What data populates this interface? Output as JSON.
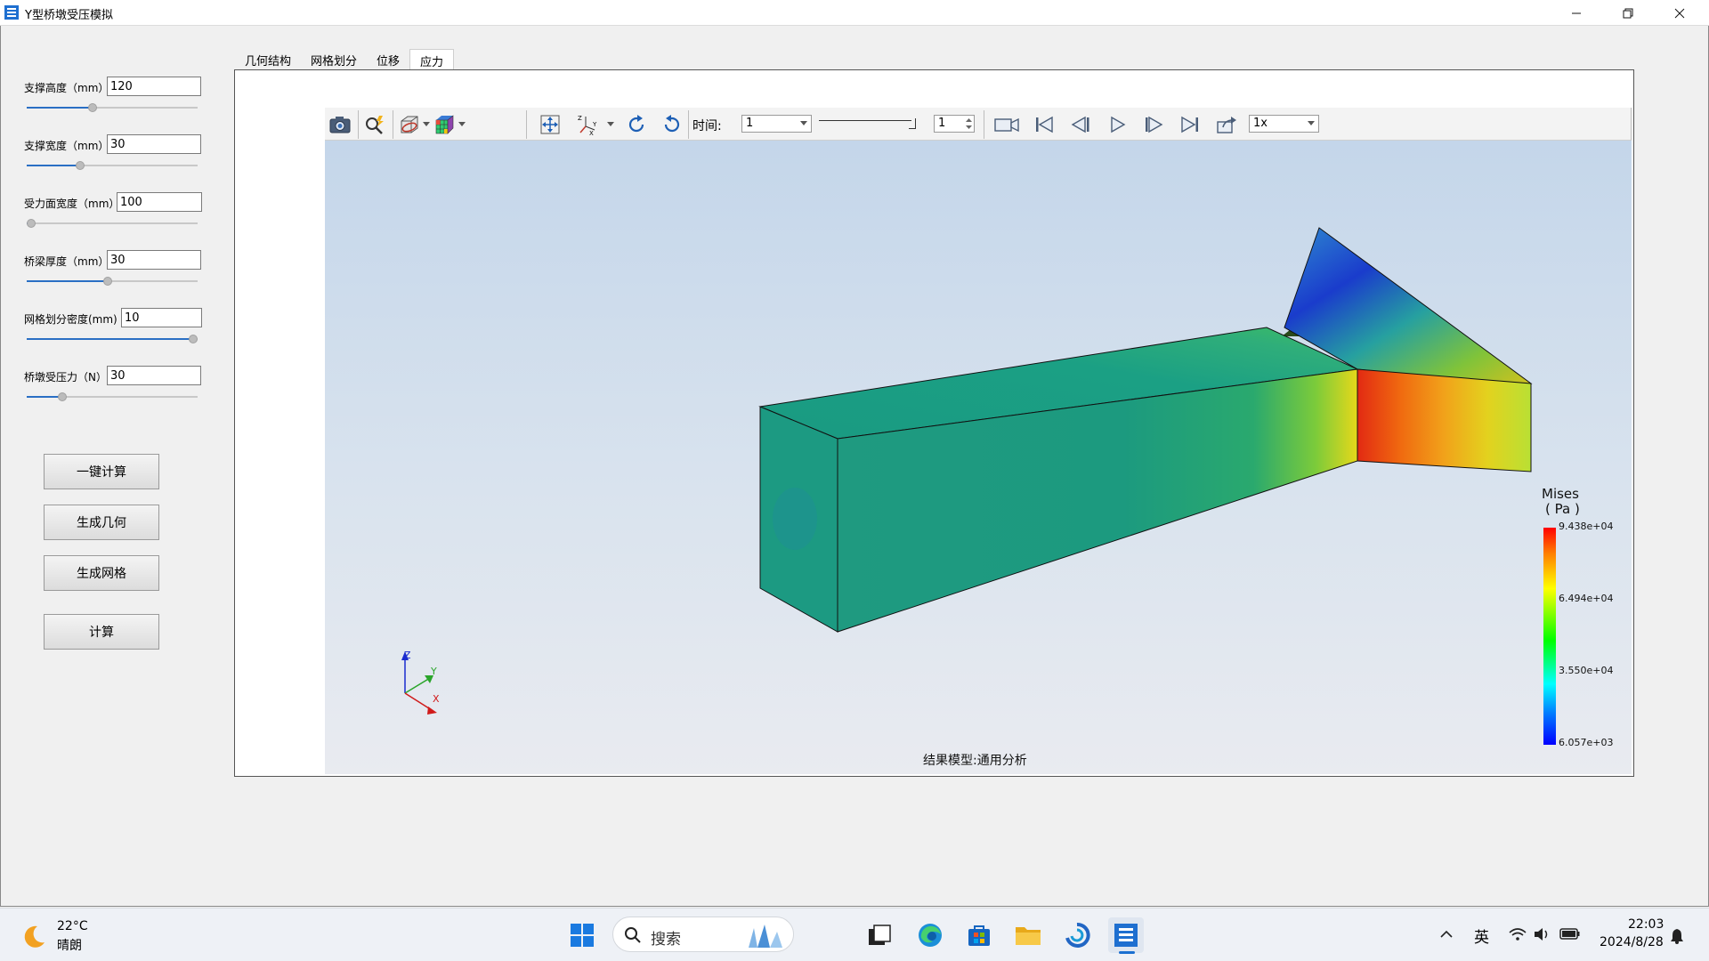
{
  "window": {
    "title": "Y型桥墩受压模拟"
  },
  "params": [
    {
      "label": "支撑高度（mm）",
      "value": "120",
      "slider_fraction": 0.38
    },
    {
      "label": "支撑宽度（mm）",
      "value": "30",
      "slider_fraction": 0.3
    },
    {
      "label": "受力面宽度（mm）",
      "value": "100",
      "slider_fraction": 0.0
    },
    {
      "label": "桥梁厚度（mm）",
      "value": "30",
      "slider_fraction": 0.47
    },
    {
      "label": "网格划分密度(mm)",
      "value": "10",
      "slider_fraction": 1.0
    },
    {
      "label": "桥墩受压力（N）",
      "value": "30",
      "slider_fraction": 0.19
    }
  ],
  "buttons": {
    "one_click": "一键计算",
    "gen_geometry": "生成几何",
    "gen_mesh": "生成网格",
    "compute": "计算"
  },
  "tabs": [
    {
      "label": "几何结构"
    },
    {
      "label": "网格划分"
    },
    {
      "label": "位移"
    },
    {
      "label": "应力",
      "active": true
    }
  ],
  "toolbar": {
    "time_label": "时间:",
    "time_value": "1",
    "frame_value": "1",
    "speed_value": "1x"
  },
  "viewport": {
    "result_model": "结果模型:通用分析",
    "axes": {
      "x": "X",
      "y": "Y",
      "z": "Z"
    },
    "legend": {
      "title": "Mises",
      "unit": "( Pa )",
      "values": [
        "9.438e+04",
        "6.494e+04",
        "3.550e+04",
        "6.057e+03"
      ]
    }
  },
  "taskbar": {
    "weather_temp": "22°C",
    "weather_desc": "晴朗",
    "search_placeholder": "搜索",
    "ime": "英",
    "time": "22:03",
    "date": "2024/8/28"
  },
  "colors": {
    "accent": "#2a6fc4",
    "viewport_top": "#c4d6ea",
    "viewport_bottom": "#e9ebf0"
  }
}
